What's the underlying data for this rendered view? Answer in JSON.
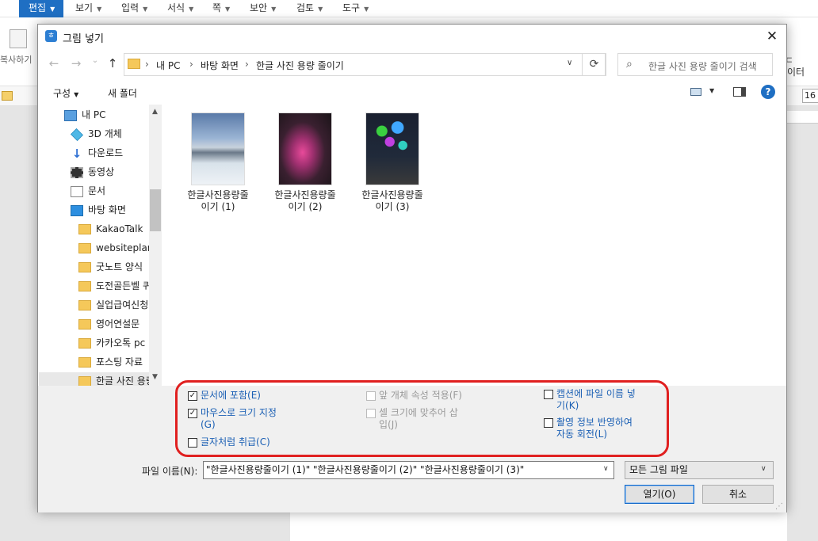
{
  "app": {
    "menus": [
      "편집",
      "보기",
      "입력",
      "서식",
      "쪽",
      "보안",
      "검토",
      "도구"
    ],
    "copy_label": "복사하기",
    "right_label_1": "ㄷ",
    "right_label_2": "이터",
    "zoom": "16"
  },
  "dialog": {
    "title": "그림 넣기",
    "close": "✕",
    "nav": {
      "back": "←",
      "forward": "→",
      "recent": "⌄",
      "up": "↑"
    },
    "breadcrumb": [
      "내 PC",
      "바탕 화면",
      "한글 사진 용량 줄이기"
    ],
    "search_placeholder": "한글 사진 용량 줄이기 검색",
    "toolbar": {
      "organize": "구성",
      "new_folder": "새 폴더",
      "help": "?"
    },
    "nav_items": [
      {
        "label": "내 PC",
        "icon": "pc-icon"
      },
      {
        "label": "3D 개체",
        "icon": "3d-objects-icon"
      },
      {
        "label": "다운로드",
        "icon": "download-icon"
      },
      {
        "label": "동영상",
        "icon": "video-icon"
      },
      {
        "label": "문서",
        "icon": "document-icon"
      },
      {
        "label": "바탕 화면",
        "icon": "desktop-icon"
      },
      {
        "label": "KakaoTalk",
        "icon": "folder-icon"
      },
      {
        "label": "websiteplanet",
        "icon": "folder-icon"
      },
      {
        "label": "굿노트 양식",
        "icon": "folder-icon"
      },
      {
        "label": "도전골든벨 퀴즈",
        "icon": "folder-icon"
      },
      {
        "label": "실업급여신청",
        "icon": "folder-icon"
      },
      {
        "label": "영어연설문",
        "icon": "folder-icon"
      },
      {
        "label": "카카오톡 pc",
        "icon": "folder-icon"
      },
      {
        "label": "포스팅 자료",
        "icon": "folder-icon"
      },
      {
        "label": "한글 사진 용량 줄이기",
        "icon": "folder-icon"
      }
    ],
    "files": [
      {
        "line1": "한글사진용량줄",
        "line2": "이기 (1)"
      },
      {
        "line1": "한글사진용량줄",
        "line2": "이기 (2)"
      },
      {
        "line1": "한글사진용량줄",
        "line2": "이기 (3)"
      }
    ],
    "options": {
      "include_in_doc": {
        "label": "문서에 포함(E)",
        "checked": true
      },
      "mouse_resize_1": "마우스로 크기 지정",
      "mouse_resize_2": "(G)",
      "mouse_resize_checked": true,
      "treat_as_char": {
        "label": "글자처럼 취급(C)",
        "checked": false
      },
      "apply_prev_props": {
        "label": "앞 개체 속성 적용(F)",
        "checked": false
      },
      "fit_cell_1": "셀 크기에 맞추어 삽",
      "fit_cell_2": "입(J)",
      "caption_filename_1": "캡션에 파일 이름 넣",
      "caption_filename_2": "기(K)",
      "exif_rotate_1": "촬영 정보 반영하여",
      "exif_rotate_2": "자동 회전(L)",
      "highlight_color": "#e02020"
    },
    "filename_label": "파일 이름(N):",
    "filename_value": "\"한글사진용량줄이기 (1)\" \"한글사진용량줄이기 (2)\" \"한글사진용량줄이기 (3)\"",
    "file_type": "모든 그림 파일",
    "open_label": "열기(O)",
    "cancel_label": "취소"
  }
}
